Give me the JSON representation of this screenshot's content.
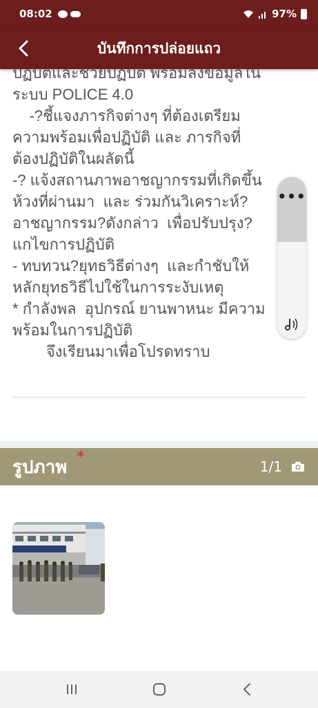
{
  "status_bar": {
    "time": "08:02",
    "battery": "97%"
  },
  "header": {
    "title": "บันทึกการปล่อยแถว"
  },
  "report": {
    "body": "ปฏิบัติและช่วยปฏิบัติ พร้อมลงข้อมูลใน\nระบบ POLICE 4.0\n    -?ชี้แจงภารกิจต่างๆ ที่ต้องเตรียม\nความพร้อมเพื่อปฏิบัติ และ ภารกิจที่\nต้องปฏิบัติในผลัดนี้\n-? แจ้งสถานภาพอาชญากรรมที่เกิดขึ้น\nห้วงที่ผ่านมา  และ ร่วมกันวิเคราะห์?\nอาชญากรรม?ดังกล่าว  เพื่อปรับปรุง?\nแกไขการปฏิบัติ\n- ทบทวน?ยุทธวิธีต่างๆ  และกำชับให้\nหลักยุทธวิธีไปใช้ในการระงับเหตุ\n* กำลังพล  อุปกรณ์ ยานพาหนะ มีความ\nพร้อมในการปฏิบัติ\n        จึงเรียนมาเพื่อโปรดทราบ"
  },
  "photos": {
    "title": "รูปภาพ",
    "required_mark": "*",
    "count": "1/1"
  },
  "floating_panel": {
    "more_label": "•••"
  },
  "colors": {
    "primary": "#6e1d1d",
    "section_header": "#a09877",
    "required": "#d8261f",
    "body_text": "#555555"
  },
  "icons": {
    "back": "chevron-left-icon",
    "camera": "camera-icon",
    "speaker": "speaker-icon",
    "nav_recents": "recent-apps-icon",
    "nav_home": "home-icon",
    "nav_back": "back-icon"
  }
}
